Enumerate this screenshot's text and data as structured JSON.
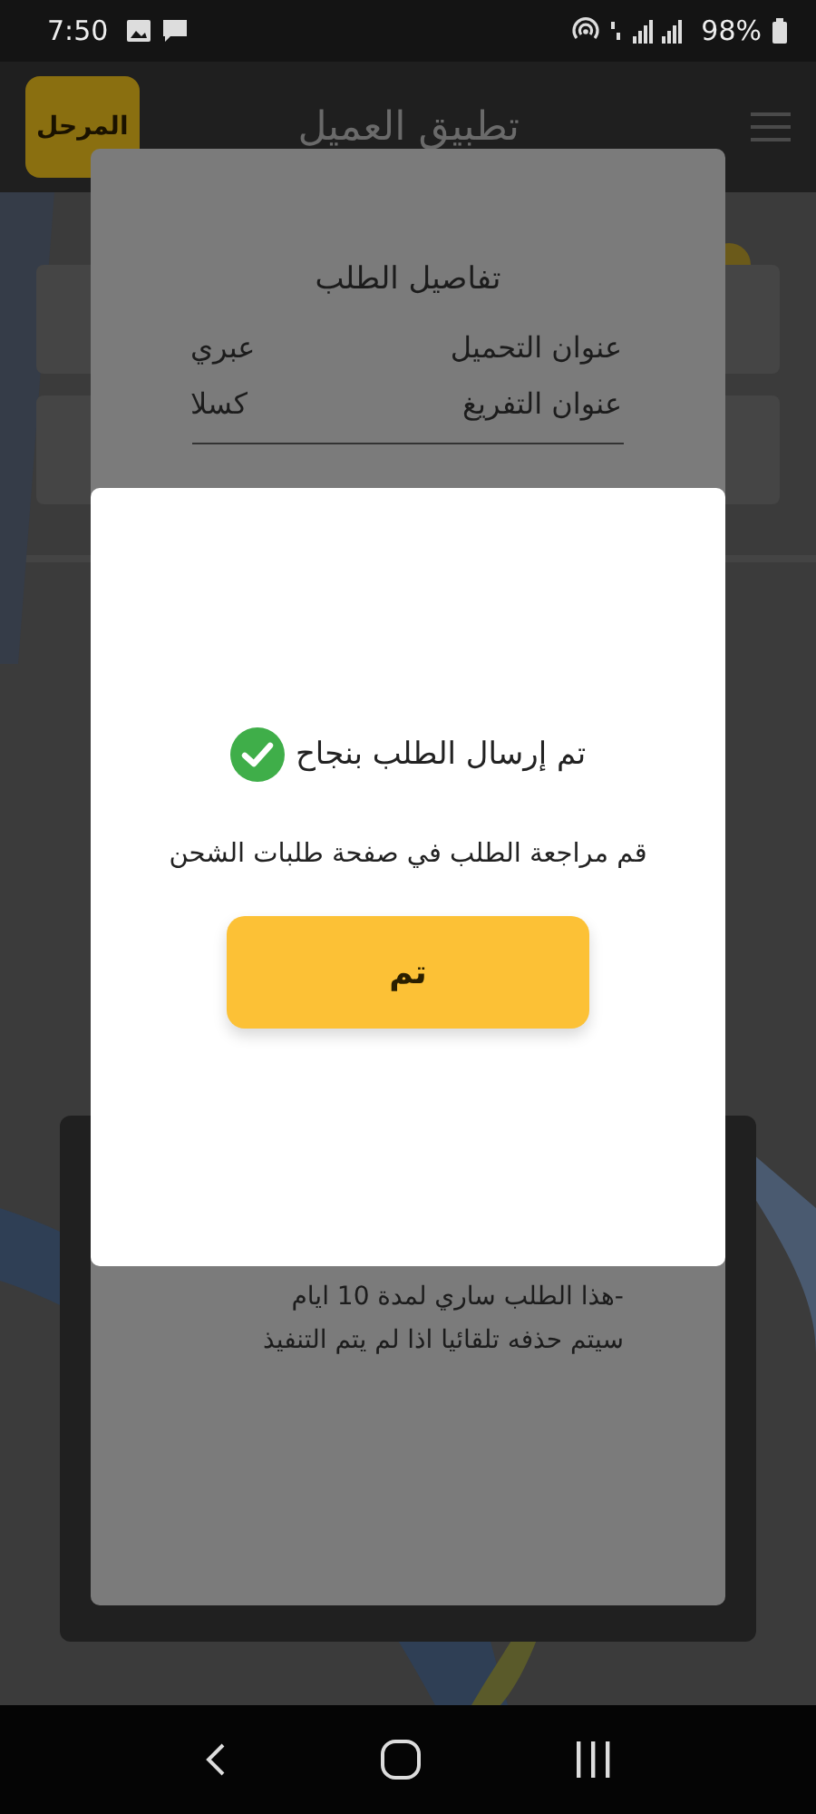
{
  "status_bar": {
    "time": "7:50",
    "battery": "98%"
  },
  "app_bar": {
    "title": "تطبيق العميل",
    "badge": "المرحل"
  },
  "details_dialog": {
    "title": "تفاصيل الطلب",
    "rows": [
      {
        "label": "عنوان التحميل",
        "value": "عبري"
      },
      {
        "label": "عنوان التفريغ",
        "value": "كسلا"
      }
    ],
    "notes": [
      "-هذا الطلب ساري لمدة 10 ايام",
      "سيتم حذفه تلقائيا اذا لم يتم التنفيذ"
    ]
  },
  "success_dialog": {
    "title": "تم إرسال الطلب بنجاح",
    "message": "قم مراجعة الطلب في صفحة طلبات الشحن",
    "button": "تم"
  }
}
